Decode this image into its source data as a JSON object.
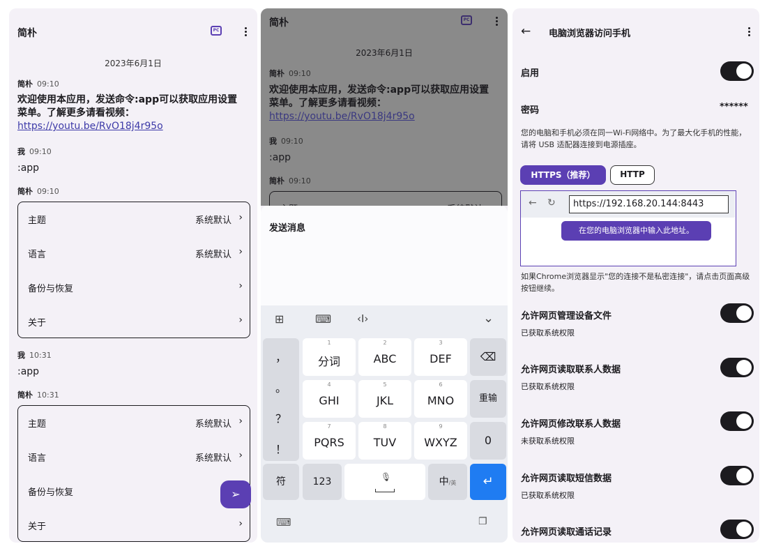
{
  "panel1": {
    "title": "简朴",
    "date": "2023年6月1日",
    "messages": [
      {
        "sender": "简朴",
        "time": "09:10",
        "text": "欢迎使用本应用，发送命令:app可以获取应用设置菜单。了解更多请看视频：",
        "link": "https://youtu.be/RvO18j4r95o"
      },
      {
        "sender": "我",
        "time": "09:10",
        "text": ":app"
      },
      {
        "sender": "简朴",
        "time": "09:10"
      },
      {
        "sender": "我",
        "time": "10:31",
        "text": ":app"
      },
      {
        "sender": "简朴",
        "time": "10:31"
      }
    ],
    "menu": [
      {
        "label": "主题",
        "value": "系统默认"
      },
      {
        "label": "语言",
        "value": "系统默认"
      },
      {
        "label": "备份与恢复",
        "value": ""
      },
      {
        "label": "关于",
        "value": ""
      }
    ]
  },
  "panel2": {
    "title": "简朴",
    "date": "2023年6月1日",
    "msg_sender": "简朴",
    "msg_time": "09:10",
    "msg_text": "欢迎使用本应用，发送命令:app可以获取应用设置菜单。了解更多请看视频：",
    "msg_link": "https://youtu.be/RvO18j4r95o",
    "me_sender": "我",
    "me_time": "09:10",
    "me_text": ":app",
    "bot_sender": "简朴",
    "bot_time": "09:10",
    "peek_label": "主题",
    "peek_value": "系统默认",
    "sheet_title": "发送消息",
    "keyboard": {
      "left_col": [
        "，",
        "。",
        "？",
        "！"
      ],
      "keys": [
        {
          "num": "1",
          "main": "分词"
        },
        {
          "num": "2",
          "main": "ABC"
        },
        {
          "num": "3",
          "main": "DEF"
        },
        {
          "num": "4",
          "main": "GHI"
        },
        {
          "num": "5",
          "main": "JKL"
        },
        {
          "num": "6",
          "main": "MNO"
        },
        {
          "num": "7",
          "main": "PQRS"
        },
        {
          "num": "8",
          "main": "TUV"
        },
        {
          "num": "9",
          "main": "WXYZ"
        }
      ],
      "retype": "重输",
      "zero": "0",
      "sym": "符",
      "num123": "123",
      "zh": "中",
      "zh_sub": "/英"
    }
  },
  "panel3": {
    "title": "电脑浏览器访问手机",
    "enable_label": "启用",
    "password_label": "密码",
    "password_value": "******",
    "hint1": "您的电脑和手机必须在同一Wi-Fi网络中。为了最大化手机的性能，请将 USB 适配器连接到电源插座。",
    "https_label": "HTTPS（推荐）",
    "http_label": "HTTP",
    "url": "https://192.168.20.144:8443",
    "tooltip": "在您的电脑浏览器中输入此地址。",
    "hint2": "如果Chrome浏览器显示\"您的连接不是私密连接\"，请点击页面高级按钮继续。",
    "permissions": [
      {
        "label": "允许网页管理设备文件",
        "status": "已获取系统权限"
      },
      {
        "label": "允许网页读取联系人数据",
        "status": "已获取系统权限"
      },
      {
        "label": "允许网页修改联系人数据",
        "status": "未获取系统权限"
      },
      {
        "label": "允许网页读取短信数据",
        "status": "已获取系统权限"
      },
      {
        "label": "允许网页读取通话记录",
        "status": ""
      }
    ]
  },
  "colors": {
    "accent": "#5b3fb3",
    "enter": "#1f7cf2",
    "bg": "#f4f1f7"
  }
}
